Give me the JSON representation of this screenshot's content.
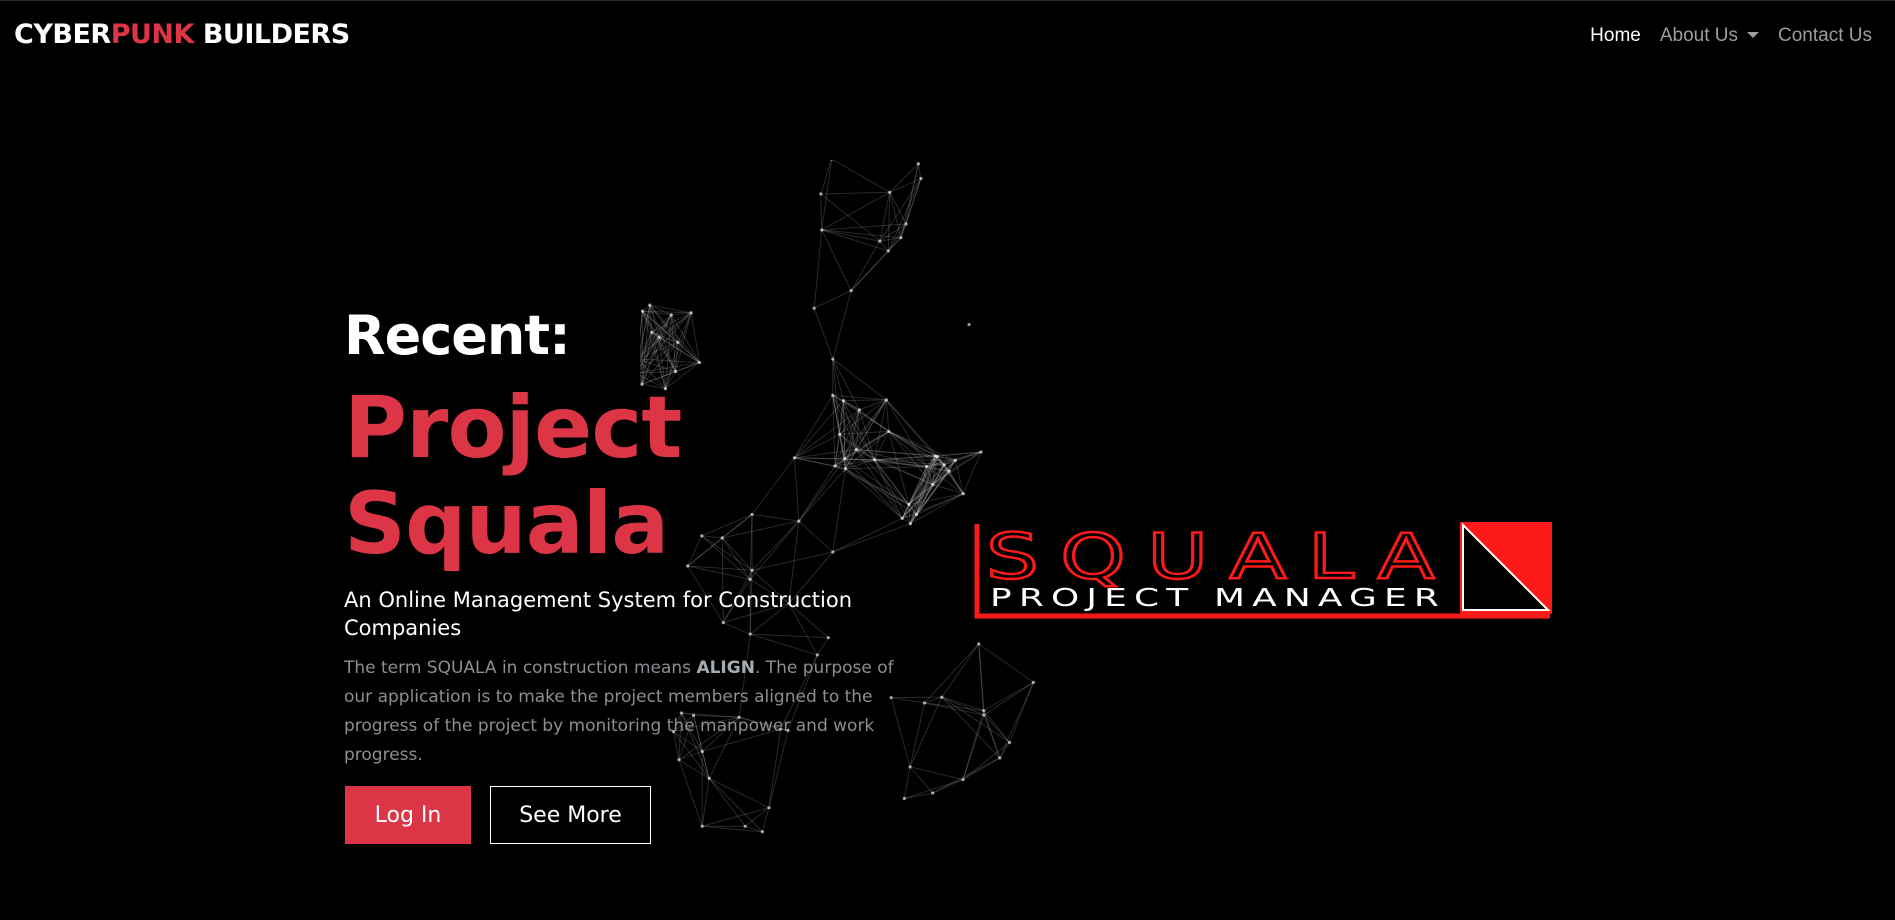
{
  "brand": {
    "part1": "CYBER",
    "part2": "PUNK",
    "part3": " BUILDERS"
  },
  "nav": {
    "items": [
      {
        "label": "Home",
        "active": true
      },
      {
        "label": "About Us",
        "dropdown": true
      },
      {
        "label": "Contact Us"
      }
    ]
  },
  "hero": {
    "label": "Recent:",
    "title_line1": "Project",
    "title_line2": "Squala",
    "subtitle": "An Online Management System for Construction Companies",
    "desc_before": "The term SQUALA in construction means ",
    "desc_bold": "ALIGN",
    "desc_after": ". The purpose of our application is to make the project members aligned to the progress of the project by monitoring the manpower and work progress.",
    "login_label": "Log In",
    "see_more_label": "See More"
  },
  "logo": {
    "word": "SQUALA",
    "tagline": "PROJECT MANAGER"
  },
  "colors": {
    "accent": "#dc3545",
    "background": "#000000",
    "muted_text": "#8a8f94",
    "logo_red": "#ff1a1a"
  }
}
